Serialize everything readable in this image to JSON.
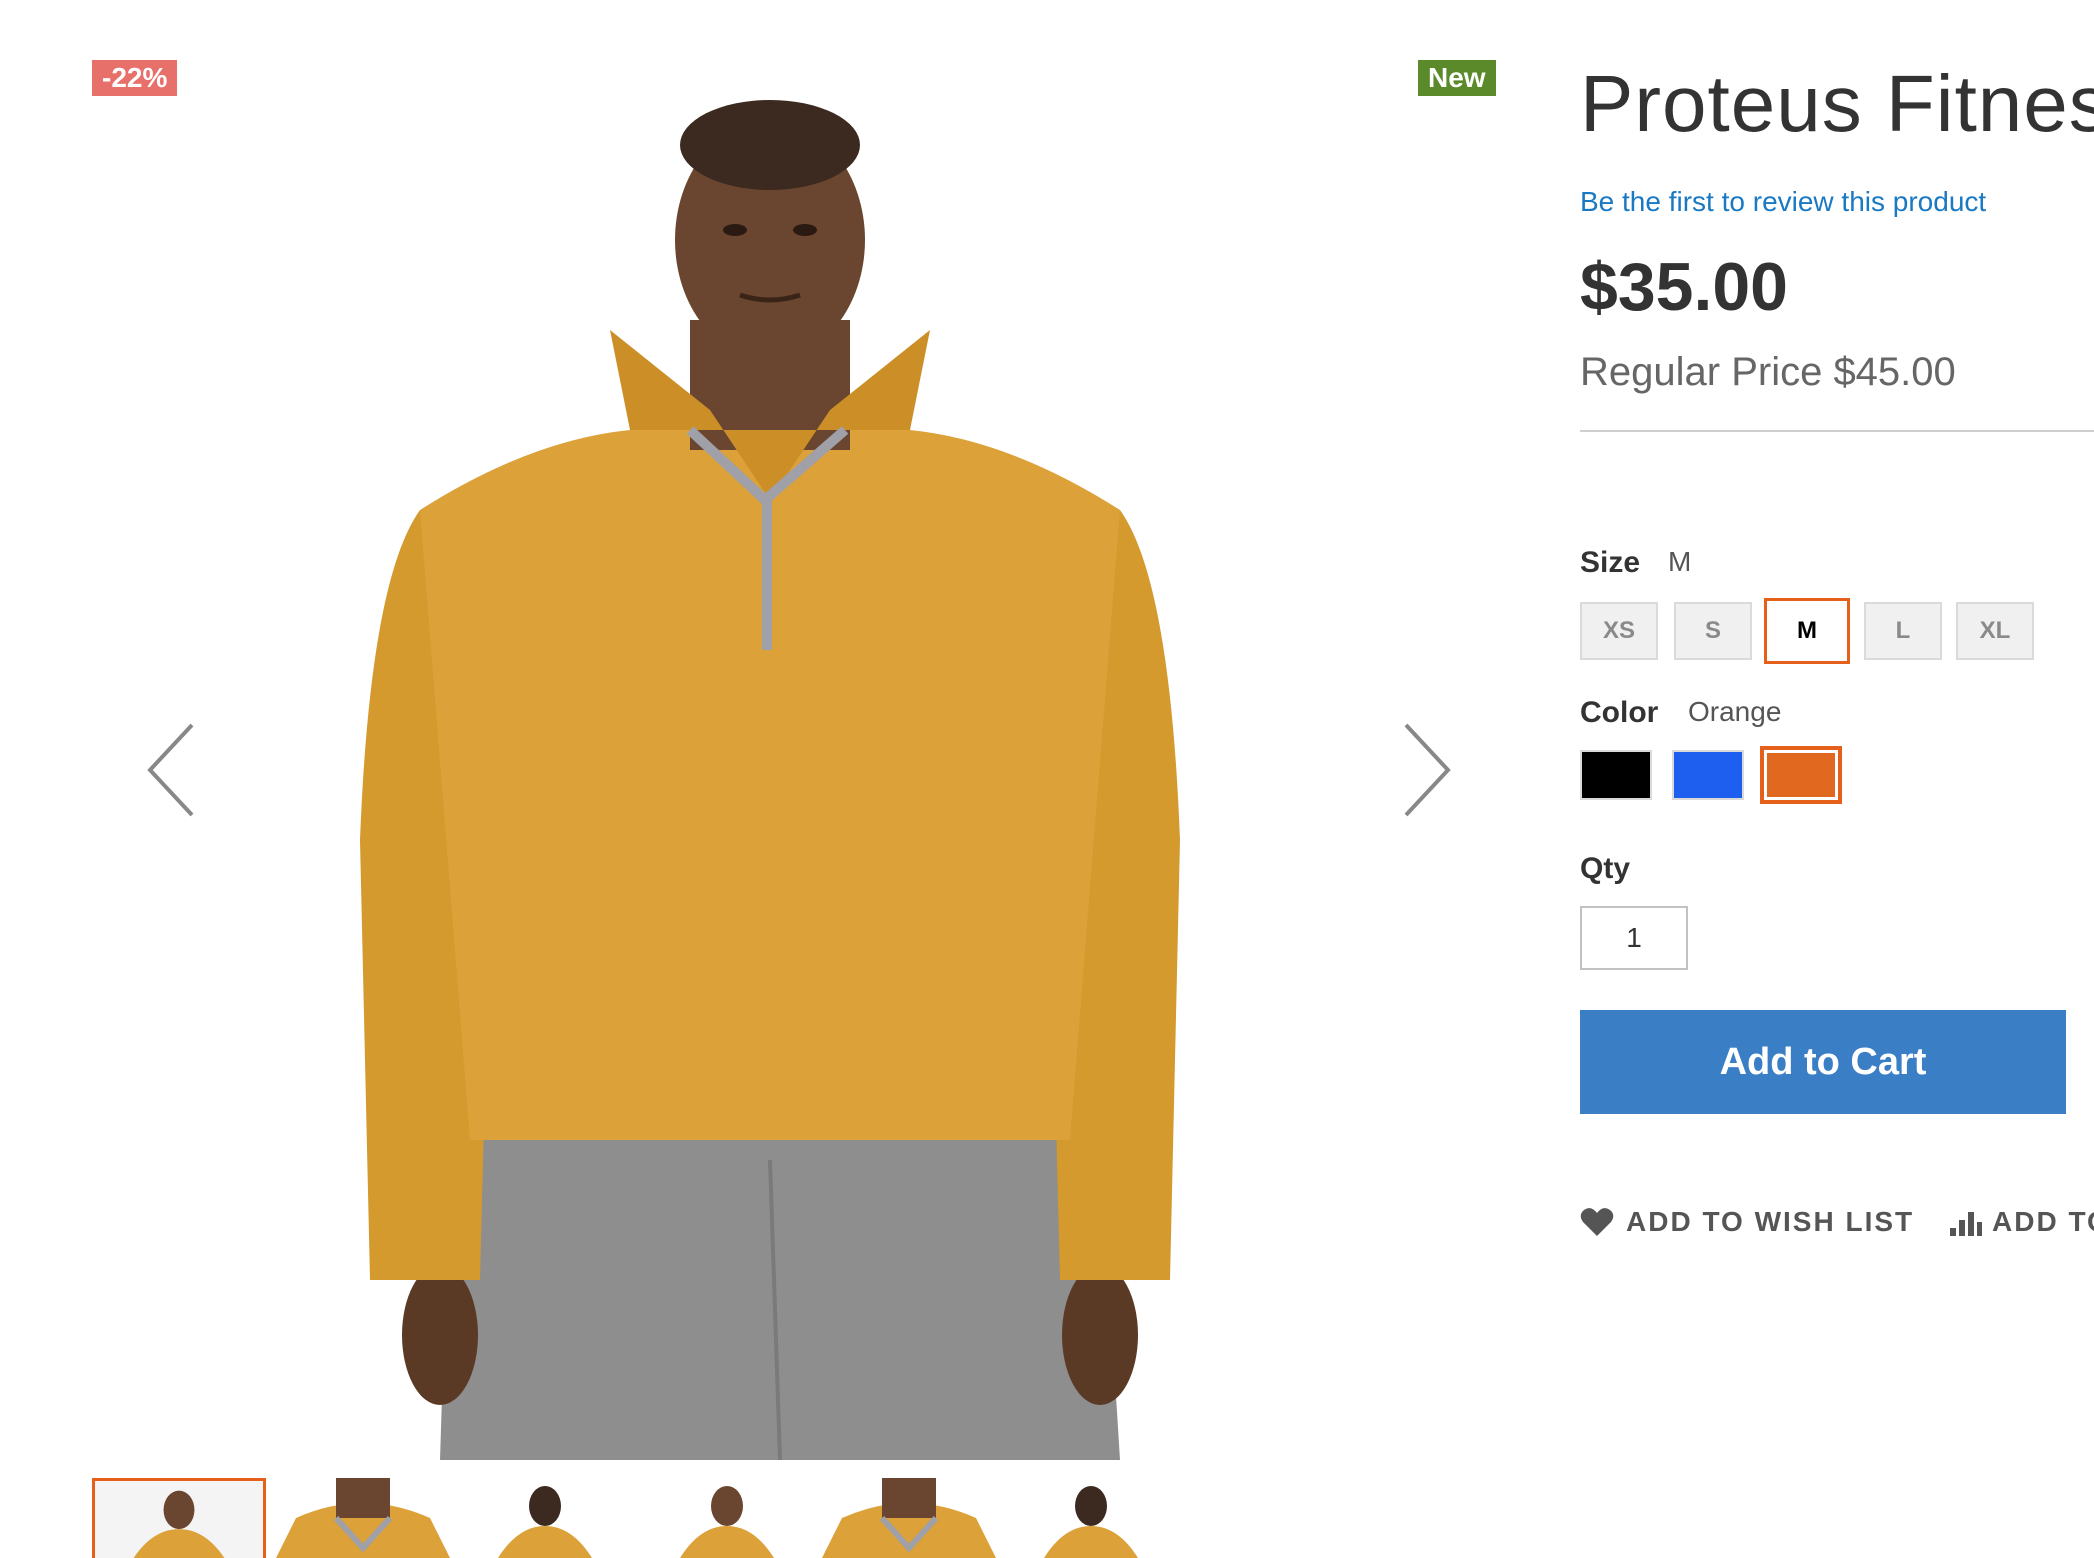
{
  "badges": {
    "discount": "-22%",
    "new": "New"
  },
  "gallery": {
    "main_image": "man-in-orange-quarter-zip-fitness-top",
    "prev_icon": "chevron-left-icon",
    "next_icon": "chevron-right-icon",
    "thumbnails": [
      {
        "view": "front-zoomed-out",
        "active": true
      },
      {
        "view": "collar-closeup",
        "active": false
      },
      {
        "view": "back",
        "active": false
      },
      {
        "view": "front",
        "active": false
      },
      {
        "view": "collar-closeup-2",
        "active": false
      },
      {
        "view": "back-2",
        "active": false
      }
    ]
  },
  "product": {
    "title": "Proteus Fitnes",
    "review_link": "Be the first to review this product",
    "price": "$35.00",
    "regular_price": "Regular Price $45.00"
  },
  "options": {
    "size": {
      "label": "Size",
      "selected": "M",
      "values": [
        "XS",
        "S",
        "M",
        "L",
        "XL"
      ]
    },
    "color": {
      "label": "Color",
      "selected": "Orange",
      "swatches": [
        {
          "name": "Black",
          "hex": "#000000"
        },
        {
          "name": "Blue",
          "hex": "#1e5ff0"
        },
        {
          "name": "Orange",
          "hex": "#e0681f"
        }
      ]
    }
  },
  "qty": {
    "label": "Qty",
    "value": "1"
  },
  "actions": {
    "add_to_cart": "Add to Cart",
    "wish_list": "ADD TO WISH LIST",
    "compare": "ADD TO"
  },
  "colors": {
    "accent": "#e5611b",
    "link": "#1979c3",
    "button": "#3a7ec6",
    "sale_badge": "#e8706b",
    "new_badge": "#5b8a2a"
  }
}
